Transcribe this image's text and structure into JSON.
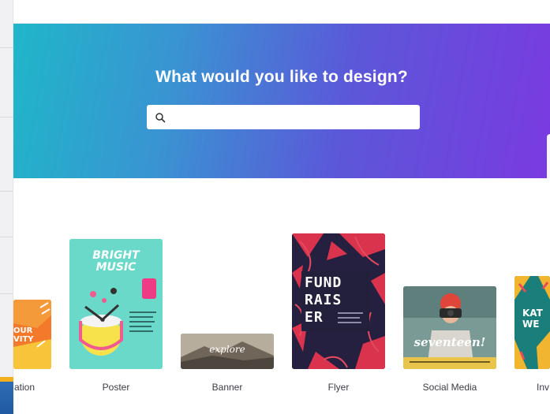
{
  "hero": {
    "title": "What would you like to design?",
    "search_placeholder": "",
    "gradient": [
      "#1fb6c9",
      "#5c57d9",
      "#7a3ae0"
    ]
  },
  "templates": [
    {
      "label": "ation",
      "card_text": "OUR\nVITY"
    },
    {
      "label": "Poster",
      "card_text": "BRIGHT\nMUSIC"
    },
    {
      "label": "Banner",
      "card_text": "explore"
    },
    {
      "label": "Flyer",
      "card_text": "FUND\nRAIS\nER"
    },
    {
      "label": "Social Media",
      "card_text": "seventeen!"
    },
    {
      "label": "Inv",
      "card_text": "KAT\nWE"
    }
  ]
}
